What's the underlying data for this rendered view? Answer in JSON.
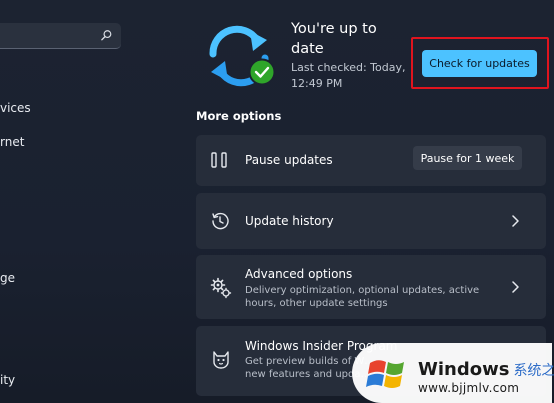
{
  "left_nav": {
    "search_placeholder": "",
    "items": [
      "vices",
      "rnet",
      "ge",
      "ity"
    ]
  },
  "status": {
    "title": "You're up to date",
    "last_checked": "Last checked: Today, 12:49 PM",
    "check_button": "Check for updates"
  },
  "more_options": {
    "heading": "More options",
    "pause": {
      "title": "Pause updates",
      "button": "Pause for 1 week"
    },
    "history": {
      "title": "Update history"
    },
    "advanced": {
      "title": "Advanced options",
      "desc": "Delivery optimization, optional updates, active hours, other update settings"
    },
    "insider": {
      "title": "Windows Insider Program",
      "desc": "Get preview builds of W… new features and upda…"
    }
  },
  "watermark": {
    "brand": "Windows",
    "brand_cn": "系统之家",
    "url": "www.bjjmlv.com"
  },
  "colors": {
    "accent": "#4cc2ff",
    "highlight_box": "#e0141e",
    "success": "#2fa52a",
    "background": "#1b2230",
    "card": "#262d3a"
  },
  "icons": [
    "search-icon",
    "sync-icon",
    "check-icon",
    "pause-icon",
    "history-icon",
    "gears-icon",
    "insider-cat-icon",
    "chevron-right-icon",
    "windows-logo"
  ]
}
